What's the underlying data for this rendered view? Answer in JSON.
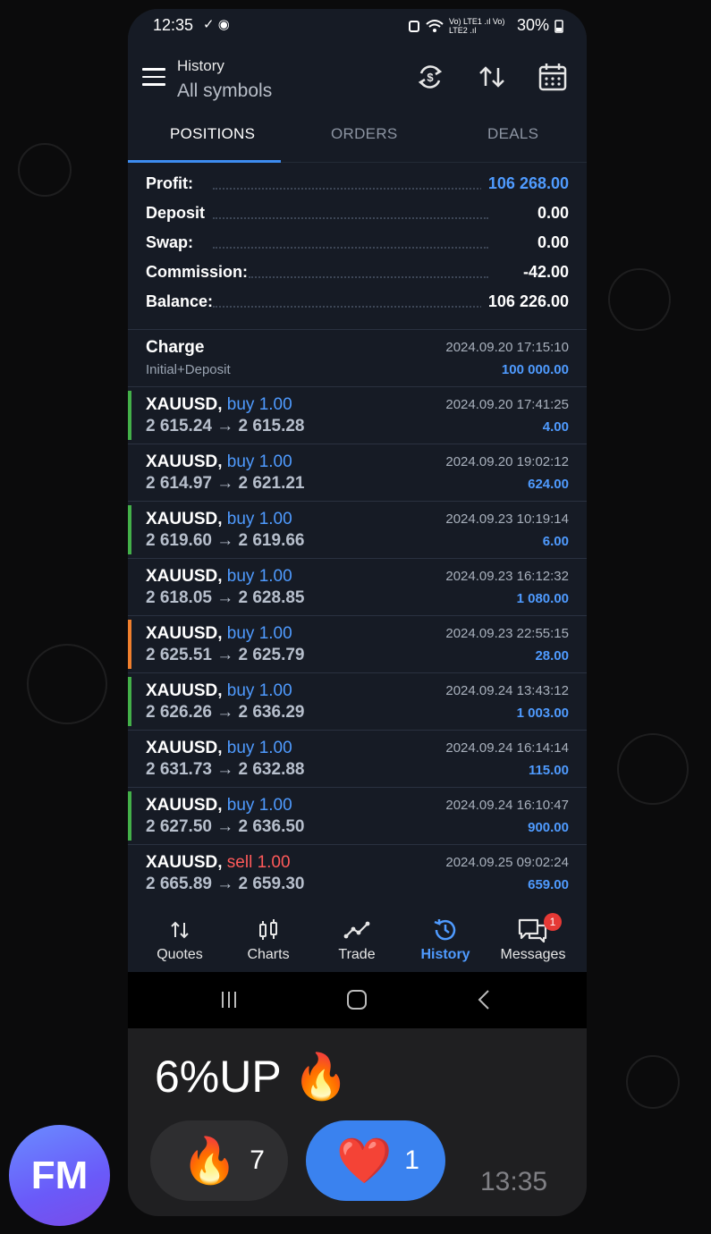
{
  "status_bar": {
    "time": "12:35",
    "icons_left": "✓ ◉",
    "net_icons": "Vo) LTE1 .ıl Vo) LTE2 .ıl",
    "battery": "30%"
  },
  "header": {
    "title_small": "History",
    "title_big": "All symbols"
  },
  "tabs": [
    {
      "label": "POSITIONS"
    },
    {
      "label": "ORDERS"
    },
    {
      "label": "DEALS"
    }
  ],
  "summary": [
    {
      "label": "Profit:",
      "value": "106 268.00"
    },
    {
      "label": "Deposit",
      "value": "0.00"
    },
    {
      "label": "Swap:",
      "value": "0.00"
    },
    {
      "label": "Commission:",
      "value": "-42.00"
    },
    {
      "label": "Balance:",
      "value": "106 226.00"
    }
  ],
  "charge": {
    "title": "Charge",
    "subtitle": "Initial+Deposit",
    "date": "2024.09.20 17:15:10",
    "amount": "100 000.00"
  },
  "trades": [
    {
      "symbol": "XAUUSD,",
      "side": "buy 1.00",
      "prices": "2 615.24 → 2 615.28",
      "date": "2024.09.20 17:41:25",
      "pnl": "4.00",
      "bar_color": "#43b049"
    },
    {
      "symbol": "XAUUSD,",
      "side": "buy 1.00",
      "prices": "2 614.97 → 2 621.21",
      "date": "2024.09.20 19:02:12",
      "pnl": "624.00",
      "bar_color": ""
    },
    {
      "symbol": "XAUUSD,",
      "side": "buy 1.00",
      "prices": "2 619.60 → 2 619.66",
      "date": "2024.09.23 10:19:14",
      "pnl": "6.00",
      "bar_color": "#43b049"
    },
    {
      "symbol": "XAUUSD,",
      "side": "buy 1.00",
      "prices": "2 618.05 → 2 628.85",
      "date": "2024.09.23 16:12:32",
      "pnl": "1 080.00",
      "bar_color": ""
    },
    {
      "symbol": "XAUUSD,",
      "side": "buy 1.00",
      "prices": "2 625.51 → 2 625.79",
      "date": "2024.09.23 22:55:15",
      "pnl": "28.00",
      "bar_color": "#f07f2d"
    },
    {
      "symbol": "XAUUSD,",
      "side": "buy 1.00",
      "prices": "2 626.26 → 2 636.29",
      "date": "2024.09.24 13:43:12",
      "pnl": "1 003.00",
      "bar_color": "#43b049"
    },
    {
      "symbol": "XAUUSD,",
      "side": "buy 1.00",
      "prices": "2 631.73 → 2 632.88",
      "date": "2024.09.24 16:14:14",
      "pnl": "115.00",
      "bar_color": ""
    },
    {
      "symbol": "XAUUSD,",
      "side": "buy 1.00",
      "prices": "2 627.50 → 2 636.50",
      "date": "2024.09.24 16:10:47",
      "pnl": "900.00",
      "bar_color": "#43b049"
    },
    {
      "symbol": "XAUUSD,",
      "side": "sell 1.00",
      "prices": "2 665.89 → 2 659.30",
      "date": "2024.09.25 09:02:24",
      "pnl": "659.00",
      "bar_color": ""
    }
  ],
  "bottom_nav": [
    {
      "label": "Quotes",
      "icon": "swap-vertical-icon"
    },
    {
      "label": "Charts",
      "icon": "candlestick-icon"
    },
    {
      "label": "Trade",
      "icon": "trend-line-icon"
    },
    {
      "label": "History",
      "icon": "history-clock-icon",
      "active": true
    },
    {
      "label": "Messages",
      "icon": "chat-icon",
      "badge": "1"
    }
  ],
  "message": {
    "caption": "6%UP 🔥",
    "reactions": [
      {
        "emoji": "🔥",
        "count": "7"
      },
      {
        "emoji": "❤️",
        "count": "1"
      }
    ],
    "time": "13:35"
  },
  "avatar": {
    "initials": "FM"
  },
  "colors": {
    "accent": "#3d8cf0",
    "profit": "#4f9bff",
    "sell": "#ff5a5a",
    "app_bg": "#161b25"
  }
}
